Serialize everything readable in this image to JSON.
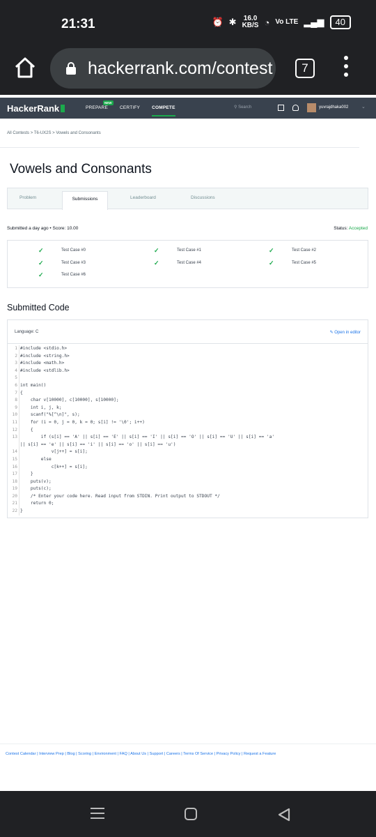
{
  "statusbar": {
    "time": "21:31",
    "net_speed": "16.0",
    "net_unit": "KB/S",
    "network": "Vo LTE",
    "battery": "40"
  },
  "browser": {
    "url": "hackerrank.com/contest",
    "tab_count": "7"
  },
  "hrnav": {
    "logo": "HackerRank",
    "new_badge": "NEW",
    "links": [
      "PREPARE",
      "CERTIFY",
      "COMPETE"
    ],
    "search_placeholder": "Search",
    "username": "yuvrajdhaka002"
  },
  "breadcrumb": {
    "items": [
      "All Contests",
      "T6-UX2S",
      "Vowels and Consonants"
    ],
    "sep": ">"
  },
  "page": {
    "title": "Vowels and Consonants"
  },
  "tabs": [
    "Problem",
    "Submissions",
    "Leaderboard",
    "Discussions"
  ],
  "submission": {
    "meta": "Submitted a day ago • Score: 10.00",
    "status_label": "Status:",
    "status_value": "Accepted"
  },
  "testcases": [
    "Test Case #0",
    "Test Case #1",
    "Test Case #2",
    "Test Case #3",
    "Test Case #4",
    "Test Case #5",
    "Test Case #6"
  ],
  "code_section": {
    "title": "Submitted Code",
    "language": "Language: C",
    "open_editor": "Open in editor",
    "lines": [
      {
        "n": "1",
        "t": "#include <stdio.h>"
      },
      {
        "n": "2",
        "t": "#include <string.h>"
      },
      {
        "n": "3",
        "t": "#include <math.h>"
      },
      {
        "n": "4",
        "t": "#include <stdlib.h>"
      },
      {
        "n": "5",
        "t": ""
      },
      {
        "n": "6",
        "t": "int main()"
      },
      {
        "n": "7",
        "t": "{"
      },
      {
        "n": "8",
        "t": "    char v[10000], c[10000], s[10000];"
      },
      {
        "n": "9",
        "t": "    int i, j, k;"
      },
      {
        "n": "10",
        "t": "    scanf(\"%[^\\n]\", s);"
      },
      {
        "n": "11",
        "t": "    for (i = 0, j = 0, k = 0; s[i] != '\\0'; i++)"
      },
      {
        "n": "12",
        "t": "    {"
      },
      {
        "n": "13",
        "t": "        if (s[i] == 'A' || s[i] == 'E' || s[i] == 'I' || s[i] == 'O' || s[i] == 'U' || s[i] == 'a'"
      },
      {
        "n": "",
        "t": "|| s[i] == 'e' || s[i] == 'i' || s[i] == 'o' || s[i] == 'u')"
      },
      {
        "n": "14",
        "t": "            v[j++] = s[i];"
      },
      {
        "n": "15",
        "t": "        else"
      },
      {
        "n": "16",
        "t": "            c[k++] = s[i];"
      },
      {
        "n": "17",
        "t": "    }"
      },
      {
        "n": "18",
        "t": "    puts(v);"
      },
      {
        "n": "19",
        "t": "    puts(c);"
      },
      {
        "n": "20",
        "t": "    /* Enter your code here. Read input from STDIN. Print output to STDOUT */"
      },
      {
        "n": "21",
        "t": "    return 0;"
      },
      {
        "n": "22",
        "t": "}"
      }
    ]
  },
  "footer": {
    "links": "Contest Calendar | Interview Prep | Blog | Scoring | Environment | FAQ | About Us | Support | Careers | Terms Of Service | Privacy Policy | Request a Feature"
  },
  "colors": {
    "accent": "#1ba94c",
    "nav_bg": "#39424e",
    "link": "#1a73e8"
  }
}
